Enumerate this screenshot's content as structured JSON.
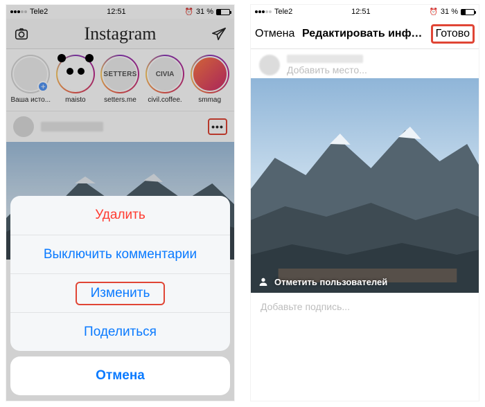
{
  "status": {
    "carrier": "Tele2",
    "time": "12:51",
    "alarm_icon": "⏰",
    "battery_text": "31 %"
  },
  "left": {
    "logo": "Instagram",
    "stories": [
      {
        "label": "Ваша исто...",
        "kind": "your-story"
      },
      {
        "label": "maisto",
        "kind": "maisto"
      },
      {
        "label": "setters.me",
        "kind": "setters",
        "text": "SETTERS"
      },
      {
        "label": "civil.coffee.",
        "kind": "civia",
        "text": "CIVIA"
      },
      {
        "label": "smmag",
        "kind": "smmag"
      }
    ],
    "actionsheet": {
      "delete": "Удалить",
      "disable_comments": "Выключить комментарии",
      "edit": "Изменить",
      "share": "Поделиться",
      "cancel": "Отмена"
    }
  },
  "right": {
    "cancel": "Отмена",
    "title": "Редактировать информа...",
    "done": "Готово",
    "location_placeholder": "Добавить место...",
    "tag_users": "Отметить пользователей",
    "caption_placeholder": "Добавьте подпись..."
  }
}
